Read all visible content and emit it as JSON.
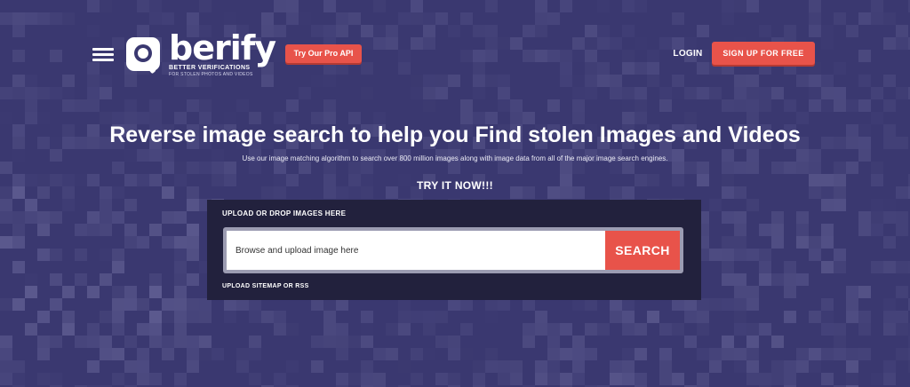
{
  "header": {
    "menu_icon": "hamburger-menu-icon",
    "logo": {
      "wordmark": "berify",
      "tagline": "BETTER VERIFICATIONS",
      "subtagline": "FOR STOLEN PHOTOS AND VIDEOS",
      "icon": "magnifier-logo-icon"
    },
    "pro_api_label": "Try Our Pro API",
    "login_label": "LOGIN",
    "signup_label": "SIGN UP FOR FREE"
  },
  "hero": {
    "headline": "Reverse image search to help you Find stolen Images and Videos",
    "subtext": "Use our image matching algorithm to search over 800 million images along with image data from all of the major image search engines.",
    "try_now": "TRY IT NOW!!!"
  },
  "upload": {
    "heading": "UPLOAD OR DROP IMAGES HERE",
    "placeholder": "Browse and upload image here",
    "search_label": "SEARCH",
    "sitemap_label": "UPLOAD SITEMAP OR RSS"
  },
  "colors": {
    "background": "#3a3870",
    "accent": "#e8534a",
    "panel": "#22213d"
  }
}
